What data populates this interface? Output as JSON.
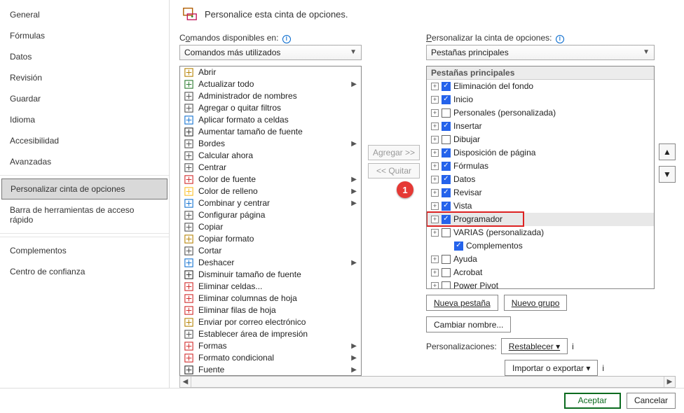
{
  "sidebar": {
    "items": [
      {
        "label": "General"
      },
      {
        "label": "Fórmulas"
      },
      {
        "label": "Datos"
      },
      {
        "label": "Revisión"
      },
      {
        "label": "Guardar"
      },
      {
        "label": "Idioma"
      },
      {
        "label": "Accesibilidad"
      },
      {
        "label": "Avanzadas"
      },
      {
        "label": "Personalizar cinta de opciones",
        "active": true
      },
      {
        "label": "Barra de herramientas de acceso rápido"
      },
      {
        "label": "Complementos"
      },
      {
        "label": "Centro de confianza"
      }
    ]
  },
  "title": "Personalice esta cinta de opciones.",
  "left": {
    "label_pre": "C",
    "label_u": "o",
    "label_post": "mandos disponibles en:",
    "select": "Comandos más utilizados",
    "commands": [
      {
        "label": "Abrir",
        "icon": "folder",
        "arrow": false
      },
      {
        "label": "Actualizar todo",
        "icon": "refresh",
        "arrow": true
      },
      {
        "label": "Administrador de nombres",
        "icon": "tag",
        "arrow": false
      },
      {
        "label": "Agregar o quitar filtros",
        "icon": "filter",
        "arrow": false
      },
      {
        "label": "Aplicar formato a celdas",
        "icon": "cells",
        "arrow": false
      },
      {
        "label": "Aumentar tamaño de fuente",
        "icon": "fontup",
        "arrow": false
      },
      {
        "label": "Bordes",
        "icon": "border",
        "arrow": true
      },
      {
        "label": "Calcular ahora",
        "icon": "calc",
        "arrow": false
      },
      {
        "label": "Centrar",
        "icon": "center",
        "arrow": false
      },
      {
        "label": "Color de fuente",
        "icon": "fontcolor",
        "arrow": true
      },
      {
        "label": "Color de relleno",
        "icon": "fill",
        "arrow": true
      },
      {
        "label": "Combinar y centrar",
        "icon": "merge",
        "arrow": true
      },
      {
        "label": "Configurar página",
        "icon": "pagecfg",
        "arrow": false
      },
      {
        "label": "Copiar",
        "icon": "copy",
        "arrow": false
      },
      {
        "label": "Copiar formato",
        "icon": "brush",
        "arrow": false
      },
      {
        "label": "Cortar",
        "icon": "cut",
        "arrow": false
      },
      {
        "label": "Deshacer",
        "icon": "undo",
        "arrow": true
      },
      {
        "label": "Disminuir tamaño de fuente",
        "icon": "fontdown",
        "arrow": false
      },
      {
        "label": "Eliminar celdas...",
        "icon": "delcell",
        "arrow": false
      },
      {
        "label": "Eliminar columnas de hoja",
        "icon": "delcol",
        "arrow": false
      },
      {
        "label": "Eliminar filas de hoja",
        "icon": "delrow",
        "arrow": false
      },
      {
        "label": "Enviar por correo electrónico",
        "icon": "mail",
        "arrow": false
      },
      {
        "label": "Establecer área de impresión",
        "icon": "printarea",
        "arrow": false
      },
      {
        "label": "Formas",
        "icon": "shapes",
        "arrow": true
      },
      {
        "label": "Formato condicional",
        "icon": "condfmt",
        "arrow": true
      },
      {
        "label": "Fuente",
        "icon": "font",
        "arrow": true
      }
    ]
  },
  "mid": {
    "add": "Agregar >>",
    "remove": "<< Quitar"
  },
  "right": {
    "label_u": "P",
    "label_post": "ersonalizar la cinta de opciones:",
    "select": "Pestañas principales",
    "tree_header": "Pestañas principales",
    "items": [
      {
        "label": "Eliminación del fondo",
        "checked": true,
        "plus": true
      },
      {
        "label": "Inicio",
        "checked": true,
        "plus": true
      },
      {
        "label": "Personales (personalizada)",
        "checked": false,
        "plus": true
      },
      {
        "label": "Insertar",
        "checked": true,
        "plus": true
      },
      {
        "label": "Dibujar",
        "checked": false,
        "plus": true
      },
      {
        "label": "Disposición de página",
        "checked": true,
        "plus": true
      },
      {
        "label": "Fórmulas",
        "checked": true,
        "plus": true
      },
      {
        "label": "Datos",
        "checked": true,
        "plus": true
      },
      {
        "label": "Revisar",
        "checked": true,
        "plus": true
      },
      {
        "label": "Vista",
        "checked": true,
        "plus": true
      },
      {
        "label": "Programador",
        "checked": true,
        "plus": true,
        "highlight": true,
        "redbox": true
      },
      {
        "label": "VARIAS (personalizada)",
        "checked": false,
        "plus": true
      },
      {
        "label": "Complementos",
        "checked": true,
        "plus": false,
        "indent": true
      },
      {
        "label": "Ayuda",
        "checked": false,
        "plus": true
      },
      {
        "label": "Acrobat",
        "checked": false,
        "plus": true
      },
      {
        "label": "Power Pivot",
        "checked": false,
        "plus": true
      }
    ],
    "btn_newtab": "Nueva pestaña",
    "btn_newgroup": "Nuevo grupo",
    "btn_rename": "Cambiar nombre...",
    "pers_label": "Personalizaciones:",
    "btn_reset": "Restablecer ▾",
    "btn_export": "Importar o exportar ▾"
  },
  "footer": {
    "ok": "Aceptar",
    "cancel": "Cancelar"
  },
  "callout": "1"
}
